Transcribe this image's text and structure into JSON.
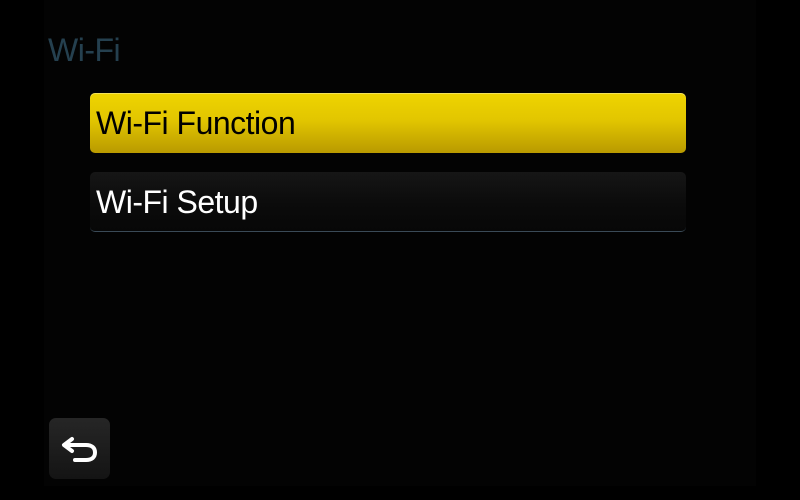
{
  "header": {
    "title": "Wi-Fi"
  },
  "menu": {
    "items": [
      {
        "label": "Wi-Fi Function",
        "selected": true
      },
      {
        "label": "Wi-Fi Setup",
        "selected": false
      }
    ]
  },
  "controls": {
    "back_icon": "return-arrow-icon"
  },
  "colors": {
    "highlight": "#e2c600",
    "title": "#25404f",
    "background": "#000000"
  }
}
